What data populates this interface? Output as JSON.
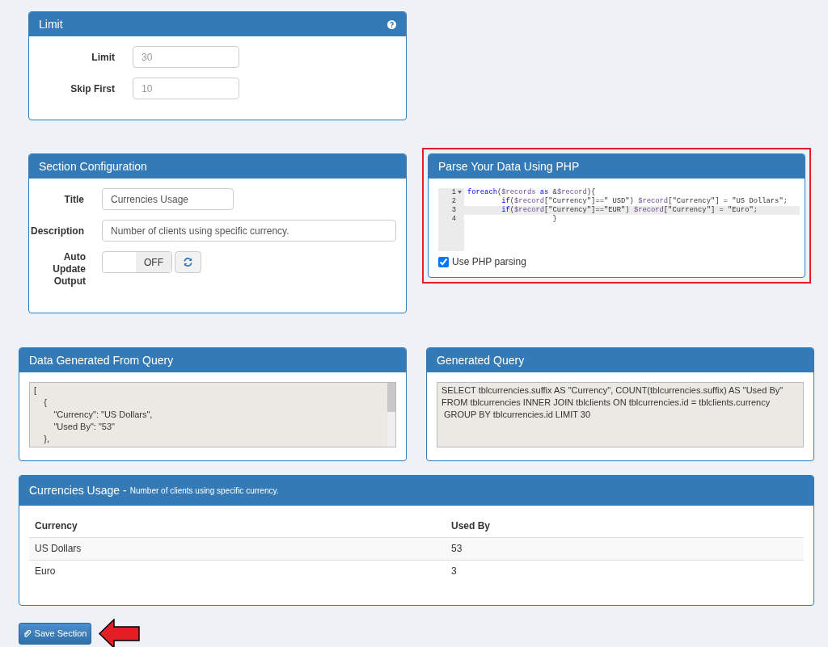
{
  "limit_panel": {
    "title": "Limit",
    "fields": [
      {
        "label": "Limit",
        "placeholder": "30"
      },
      {
        "label": "Skip First",
        "placeholder": "10"
      }
    ]
  },
  "section_configuration": {
    "title": "Section Configuration",
    "fields": [
      {
        "kind": "text",
        "label": "Title",
        "value": "Currencies Usage"
      },
      {
        "kind": "text",
        "label": "Description",
        "value": "Number of clients using specific currency."
      },
      {
        "kind": "toggle",
        "label": "Auto Update Output",
        "state_label": "OFF",
        "on": false
      }
    ]
  },
  "php_panel": {
    "title": "Parse Your Data Using PHP",
    "highlighted": true,
    "editor": {
      "lines": [
        {
          "number": "1",
          "foldable": true,
          "active": false,
          "tokens": [
            {
              "kind": "keyword",
              "text": "foreach"
            },
            {
              "kind": "plain",
              "text": "("
            },
            {
              "kind": "variable",
              "text": "$records"
            },
            {
              "kind": "keyword",
              "text": " as "
            },
            {
              "kind": "plain",
              "text": "&"
            },
            {
              "kind": "variable",
              "text": "$record"
            },
            {
              "kind": "plain",
              "text": "){"
            }
          ]
        },
        {
          "number": "2",
          "foldable": false,
          "active": false,
          "tokens": [
            {
              "kind": "keyword",
              "text": "        if"
            },
            {
              "kind": "plain",
              "text": "("
            },
            {
              "kind": "variable",
              "text": "$record"
            },
            {
              "kind": "plain",
              "text": "[\"Currency\"]==\" USD\") "
            },
            {
              "kind": "variable",
              "text": "$record"
            },
            {
              "kind": "plain",
              "text": "[\"Currency\"] = \"US Dollars\";"
            }
          ]
        },
        {
          "number": "3",
          "foldable": false,
          "active": true,
          "tokens": [
            {
              "kind": "keyword",
              "text": "        if"
            },
            {
              "kind": "plain",
              "text": "("
            },
            {
              "kind": "variable",
              "text": "$record"
            },
            {
              "kind": "plain",
              "text": "[\"Currency\"]==\"EUR\") "
            },
            {
              "kind": "variable",
              "text": "$record"
            },
            {
              "kind": "plain",
              "text": "[\"Currency\"] = \"Euro\";"
            }
          ]
        },
        {
          "number": "4",
          "foldable": false,
          "active": false,
          "tokens": [
            {
              "kind": "plain",
              "text": "                    }"
            }
          ]
        }
      ]
    },
    "checkbox": {
      "label": "Use PHP parsing",
      "checked": true
    }
  },
  "data_panel": {
    "title": "Data Generated From Query",
    "output": "[\n    {\n        \"Currency\": \"US Dollars\",\n        \"Used By\": \"53\"\n    },"
  },
  "query_panel": {
    "title": "Generated Query",
    "query": "SELECT tblcurrencies.suffix AS \"Currency\", COUNT(tblcurrencies.suffix) AS \"Used By\" FROM tblcurrencies INNER JOIN tblclients ON tblcurrencies.id = tblclients.currency\n GROUP BY tblcurrencies.id LIMIT 30"
  },
  "preview_panel": {
    "title": "Currencies Usage",
    "separator": "-",
    "description": "Number of clients using specific currency.",
    "table": {
      "columns": [
        "Currency",
        "Used By"
      ],
      "rows": [
        [
          "US Dollars",
          "53"
        ],
        [
          "Euro",
          "3"
        ]
      ]
    }
  },
  "save_button": {
    "label": "Save Section"
  }
}
